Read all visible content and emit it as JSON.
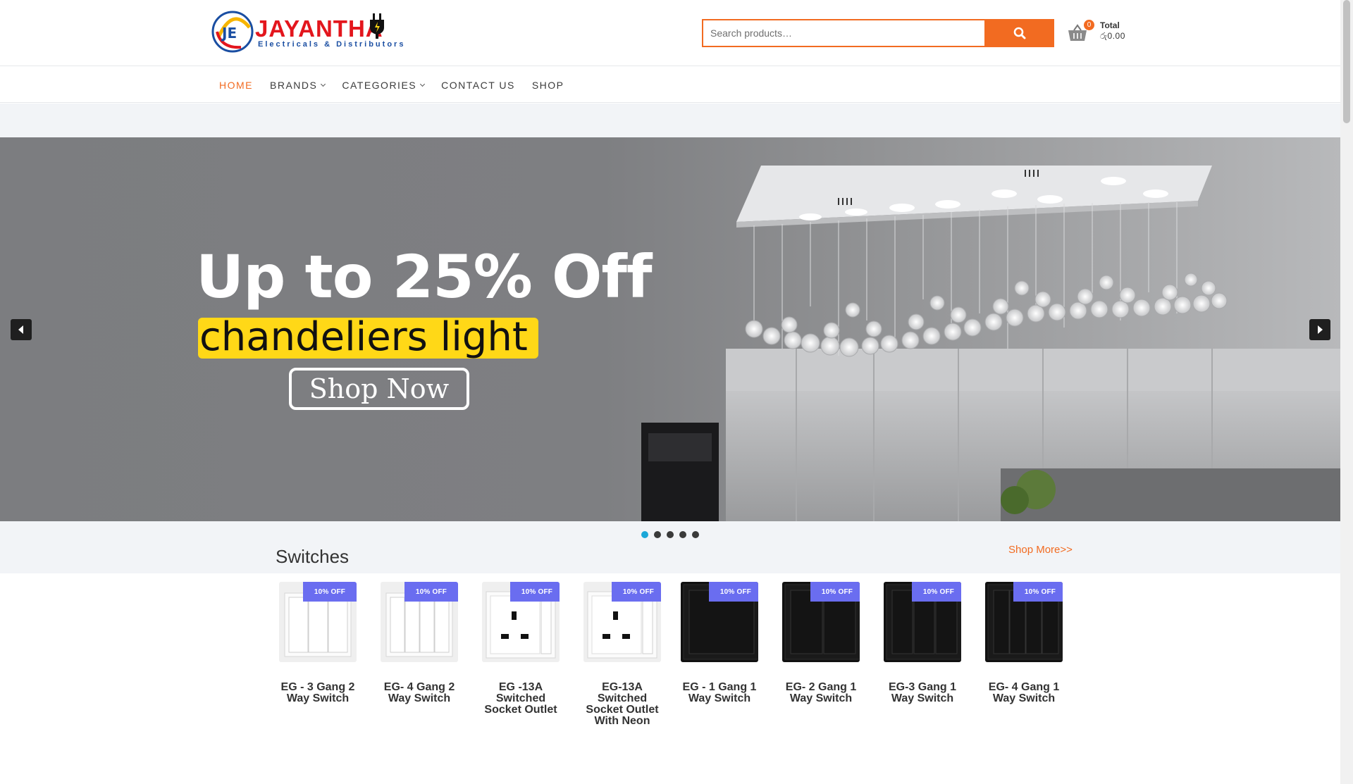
{
  "brand": {
    "emblem_text": "JE",
    "name": "JAYANTHA",
    "tagline": "Electricals & Distributors"
  },
  "search": {
    "placeholder": "Search products…",
    "value": ""
  },
  "cart": {
    "count": "0",
    "total_label": "Total",
    "total_value": "රු0.00"
  },
  "nav": {
    "items": [
      {
        "label": "HOME",
        "active": true
      },
      {
        "label": "BRANDS"
      },
      {
        "label": "CATEGORIES"
      },
      {
        "label": "CONTACT US"
      },
      {
        "label": "SHOP"
      }
    ]
  },
  "hero": {
    "headline": "Up to 25% Off",
    "subline": "chandeliers light",
    "cta": "Shop Now",
    "active_slide": 1,
    "slide_count": 5
  },
  "section": {
    "title": "Switches",
    "shop_more": "Shop More>>"
  },
  "products": [
    {
      "name": "EG - 3 Gang 2 Way Switch",
      "badge": "10% OFF",
      "style": "white-3"
    },
    {
      "name": "EG- 4 Gang 2 Way Switch",
      "badge": "10% OFF",
      "style": "white-4"
    },
    {
      "name": "EG -13A Switched Socket Outlet",
      "badge": "10% OFF",
      "style": "white-socket"
    },
    {
      "name": "EG-13A Switched Socket Outlet With Neon",
      "badge": "10% OFF",
      "style": "white-socket"
    },
    {
      "name": "EG - 1 Gang 1 Way Switch",
      "badge": "10% OFF",
      "style": "black-1"
    },
    {
      "name": "EG- 2 Gang 1 Way Switch",
      "badge": "10% OFF",
      "style": "black-2"
    },
    {
      "name": "EG-3 Gang 1 Way Switch",
      "badge": "10% OFF",
      "style": "black-3"
    },
    {
      "name": "EG- 4 Gang 1 Way Switch",
      "badge": "10% OFF",
      "style": "black-4"
    }
  ],
  "colors": {
    "accent": "#f26b21",
    "badge": "#6a6df0",
    "dot_active": "#1ba7d8"
  }
}
